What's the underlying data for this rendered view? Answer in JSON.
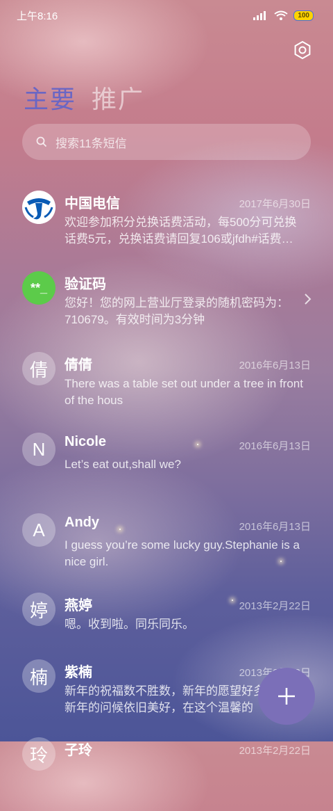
{
  "status_bar": {
    "time": "上午8:16",
    "battery": "100"
  },
  "tabs": [
    {
      "label": "主要"
    },
    {
      "label": "推广"
    }
  ],
  "search": {
    "placeholder": "搜索11条短信"
  },
  "conversations": [
    {
      "avatar": "",
      "avatar_icon": "china-telecom-logo",
      "name": "中国电信",
      "date": "2017年6月30日",
      "preview": "欢迎参加积分兑换话费活动，每500分可兑换话费5元，兑换话费请回复106或jfdh#话费…"
    },
    {
      "avatar": "**_",
      "name": "验证码",
      "date": "",
      "preview": "您好！您的网上营业厅登录的随机密码为：710679。有效时间为3分钟"
    },
    {
      "avatar": "倩",
      "name": "倩倩",
      "date": "2016年6月13日",
      "preview": "There was a table set out under a tree in front of the hous"
    },
    {
      "avatar": "N",
      "name": "Nicole",
      "date": "2016年6月13日",
      "preview": "Let’s eat out,shall we?"
    },
    {
      "avatar": "A",
      "name": "Andy",
      "date": "2016年6月13日",
      "preview": "I guess you’re some lucky guy.Stephanie is a nice girl."
    },
    {
      "avatar": "婷",
      "name": "燕婷",
      "date": "2013年2月22日",
      "preview": "嗯。收到啦。同乐同乐。"
    },
    {
      "avatar": "楠",
      "name": "紫楠",
      "date": "2013年2月22日",
      "preview": "新年的祝福数不胜数，新年的愿望好多好多，新年的问候依旧美好，在这个温馨的"
    },
    {
      "avatar": "玲",
      "name": "子玲",
      "date": "2013年2月22日",
      "preview": ""
    }
  ],
  "colors": {
    "active_tab": "#6a66c4",
    "fab": "#7b6fb8",
    "code_avatar": "#5ccb4a"
  }
}
